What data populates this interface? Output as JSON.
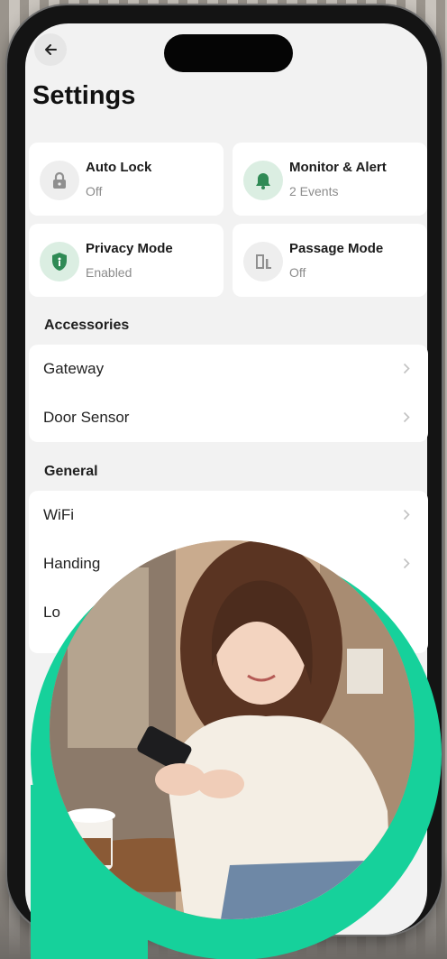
{
  "header": {
    "title": "Settings"
  },
  "status_cards": [
    {
      "label": "Auto Lock",
      "value": "Off",
      "icon": "lock-icon"
    },
    {
      "label": "Monitor & Alert",
      "value": "2 Events",
      "icon": "bell-icon"
    },
    {
      "label": "Privacy Mode",
      "value": "Enabled",
      "icon": "shield-icon"
    },
    {
      "label": "Passage Mode",
      "value": "Off",
      "icon": "door-icon"
    }
  ],
  "accessories": {
    "heading": "Accessories",
    "items": [
      {
        "label": "Gateway"
      },
      {
        "label": "Door Sensor"
      }
    ]
  },
  "general": {
    "heading": "General",
    "items": [
      {
        "label": "WiFi"
      },
      {
        "label": "Handing"
      },
      {
        "label": "Lo"
      }
    ]
  },
  "colors": {
    "accent": "#16d19b",
    "icon_green": "#2f8a55"
  }
}
